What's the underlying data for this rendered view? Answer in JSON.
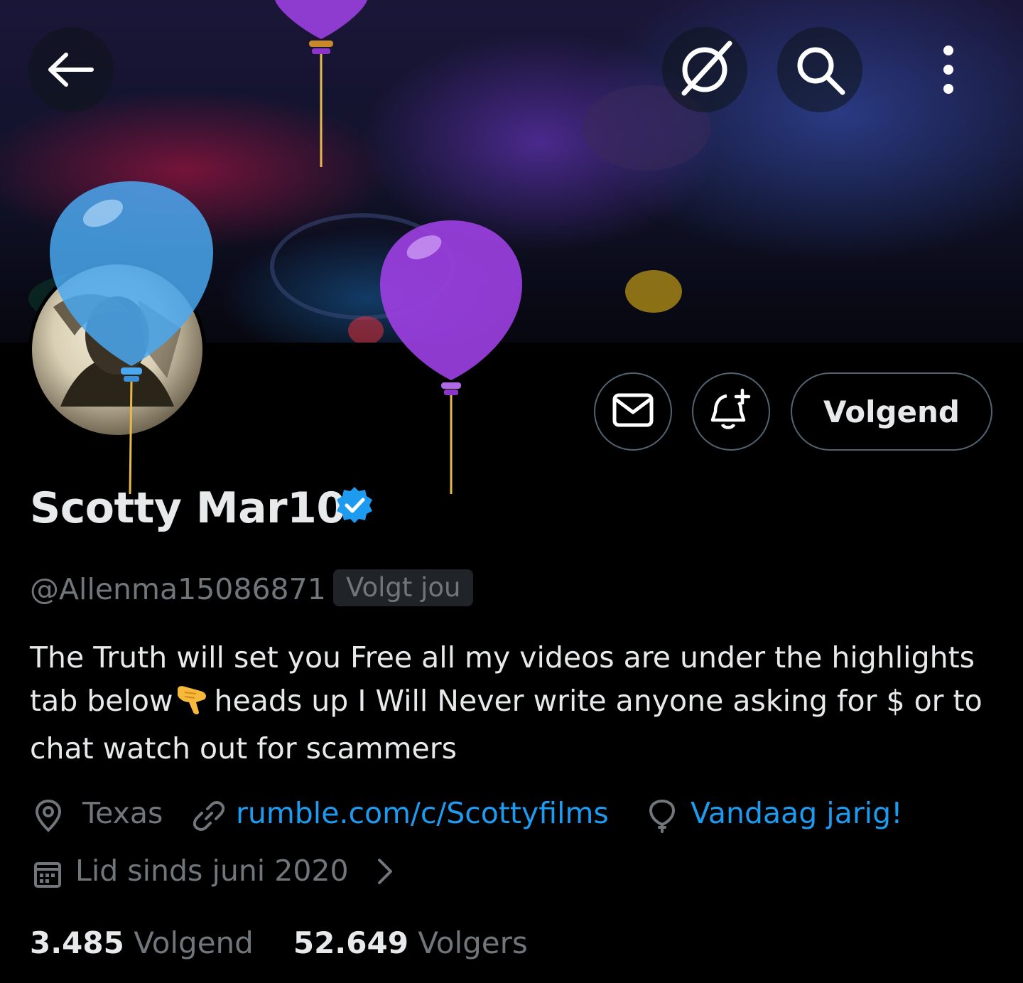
{
  "profile": {
    "display_name": "Scotty Mar10",
    "handle": "@Allenma15086871",
    "follows_you": "Volgt jou",
    "bio_line1": "The Truth will set you Free all my videos are under the highlights",
    "bio_line2_a": "tab below",
    "bio_line2_b": "heads up I Will Never write anyone asking for $ or to",
    "bio_line3": "chat watch out for scammers",
    "location": "Texas",
    "website": "rumble.com/c/Scottyfilms",
    "birthday": "Vandaag jarig!",
    "joined": "Lid sinds juni 2020",
    "following_count": "3.485",
    "following_label": "Volgend",
    "followers_count": "52.649",
    "followers_label": "Volgers"
  },
  "actions": {
    "follow_label": "Volgend"
  },
  "icons": {
    "back": "arrow-left-icon",
    "grok": "grok-icon",
    "search": "search-icon",
    "more": "more-vertical-icon",
    "message": "envelope-icon",
    "notify": "bell-plus-icon",
    "verified": "verified-badge-icon",
    "location": "location-pin-icon",
    "link": "link-icon",
    "birthday": "balloon-icon",
    "calendar": "calendar-icon",
    "chevron": "chevron-right-icon"
  },
  "colors": {
    "background": "#000000",
    "text_primary": "#e7e9ea",
    "text_secondary": "#71767b",
    "link": "#1d9bf0",
    "verified": "#1d9bf0",
    "button_border": "#536471",
    "balloon_blue": "#4aa8f0",
    "balloon_purple": "#9b3fe0"
  }
}
